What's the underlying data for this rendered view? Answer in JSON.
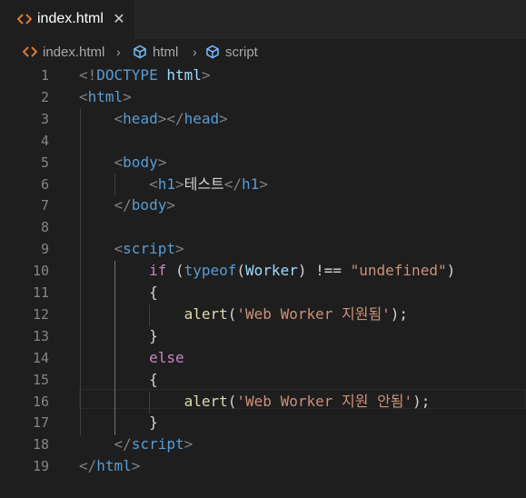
{
  "tab": {
    "label": "index.html",
    "icon": "html-icon",
    "close_symbol": "✕"
  },
  "breadcrumb": {
    "items": [
      {
        "label": "index.html",
        "icon": "html-icon"
      },
      {
        "label": "html",
        "icon": "symbol-structure-icon"
      },
      {
        "label": "script",
        "icon": "symbol-structure-icon"
      }
    ],
    "separator": "›"
  },
  "colors": {
    "background": "#1e1e1e",
    "tag": "#569cd6",
    "bracket": "#808080",
    "string": "#ce9178",
    "control_keyword": "#c586c0",
    "function": "#dcdcaa",
    "variable": "#9cdcfe",
    "line_number": "#858585",
    "html_icon": "#e37933",
    "structure_icon": "#75beff"
  },
  "editor": {
    "line_numbers": [
      "1",
      "2",
      "3",
      "4",
      "5",
      "6",
      "7",
      "8",
      "9",
      "10",
      "11",
      "12",
      "13",
      "14",
      "15",
      "16",
      "17",
      "18",
      "19"
    ],
    "lines": [
      [
        [
          "t-punc",
          "<!"
        ],
        [
          "t-tag",
          "DOCTYPE"
        ],
        [
          "t-text",
          " "
        ],
        [
          "t-var",
          "html"
        ],
        [
          "t-punc",
          ">"
        ]
      ],
      [
        [
          "t-punc",
          "<"
        ],
        [
          "t-tag",
          "html"
        ],
        [
          "t-punc",
          ">"
        ]
      ],
      [
        [
          "t-text",
          "    "
        ],
        [
          "t-punc",
          "<"
        ],
        [
          "t-tag",
          "head"
        ],
        [
          "t-punc",
          "></"
        ],
        [
          "t-tag",
          "head"
        ],
        [
          "t-punc",
          ">"
        ]
      ],
      [],
      [
        [
          "t-text",
          "    "
        ],
        [
          "t-punc",
          "<"
        ],
        [
          "t-tag",
          "body"
        ],
        [
          "t-punc",
          ">"
        ]
      ],
      [
        [
          "t-text",
          "        "
        ],
        [
          "t-punc",
          "<"
        ],
        [
          "t-tag",
          "h1"
        ],
        [
          "t-punc",
          ">"
        ],
        [
          "t-text",
          "테스트"
        ],
        [
          "t-punc",
          "</"
        ],
        [
          "t-tag",
          "h1"
        ],
        [
          "t-punc",
          ">"
        ]
      ],
      [
        [
          "t-text",
          "    "
        ],
        [
          "t-punc",
          "</"
        ],
        [
          "t-tag",
          "body"
        ],
        [
          "t-punc",
          ">"
        ]
      ],
      [],
      [
        [
          "t-text",
          "    "
        ],
        [
          "t-punc",
          "<"
        ],
        [
          "t-tag",
          "script"
        ],
        [
          "t-punc",
          ">"
        ]
      ],
      [
        [
          "t-text",
          "        "
        ],
        [
          "t-ctrl",
          "if"
        ],
        [
          "t-op",
          " ("
        ],
        [
          "t-kw",
          "typeof"
        ],
        [
          "t-op",
          "("
        ],
        [
          "t-var",
          "Worker"
        ],
        [
          "t-op",
          ") !== "
        ],
        [
          "t-str",
          "\"undefined\""
        ],
        [
          "t-op",
          ")"
        ]
      ],
      [
        [
          "t-text",
          "        "
        ],
        [
          "t-op",
          "{"
        ]
      ],
      [
        [
          "t-text",
          "            "
        ],
        [
          "t-fn",
          "alert"
        ],
        [
          "t-op",
          "("
        ],
        [
          "t-str",
          "'Web Worker 지원됨'"
        ],
        [
          "t-op",
          ");"
        ]
      ],
      [
        [
          "t-text",
          "        "
        ],
        [
          "t-op",
          "}"
        ]
      ],
      [
        [
          "t-text",
          "        "
        ],
        [
          "t-ctrl",
          "else"
        ]
      ],
      [
        [
          "t-text",
          "        "
        ],
        [
          "t-op",
          "{"
        ]
      ],
      [
        [
          "t-text",
          "            "
        ],
        [
          "t-fn",
          "alert"
        ],
        [
          "t-op",
          "("
        ],
        [
          "t-str",
          "'Web Worker 지원 안됨'"
        ],
        [
          "t-op",
          ");"
        ]
      ],
      [
        [
          "t-text",
          "        "
        ],
        [
          "t-op",
          "}"
        ]
      ],
      [
        [
          "t-text",
          "    "
        ],
        [
          "t-punc",
          "</"
        ],
        [
          "t-tag",
          "script"
        ],
        [
          "t-punc",
          ">"
        ]
      ],
      [
        [
          "t-punc",
          "</"
        ],
        [
          "t-tag",
          "html"
        ],
        [
          "t-punc",
          ">"
        ]
      ]
    ]
  }
}
